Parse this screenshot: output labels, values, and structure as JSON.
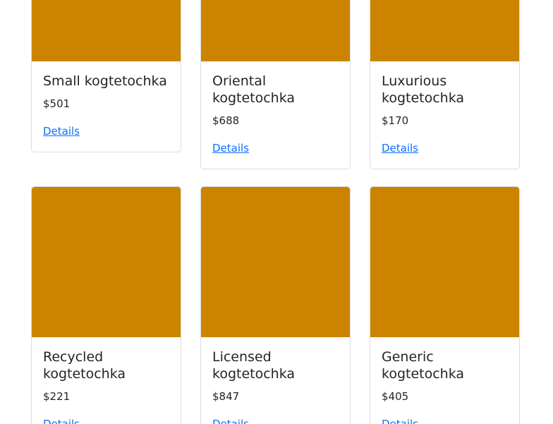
{
  "products": [
    {
      "title": "Small kogtetochka",
      "price": "$501",
      "link": "Details",
      "image_color": "#cc8400"
    },
    {
      "title": "Oriental kogtetochka",
      "price": "$688",
      "link": "Details",
      "image_color": "#cc8400"
    },
    {
      "title": "Luxurious kogtetochka",
      "price": "$170",
      "link": "Details",
      "image_color": "#cc8400"
    },
    {
      "title": "Recycled kogtetochka",
      "price": "$221",
      "link": "Details",
      "image_color": "#cc8400"
    },
    {
      "title": "Licensed kogtetochka",
      "price": "$847",
      "link": "Details",
      "image_color": "#cc8400"
    },
    {
      "title": "Generic kogtetochka",
      "price": "$405",
      "link": "Details",
      "image_color": "#cc8400"
    }
  ],
  "colors": {
    "image_placeholder": "#cc8400",
    "link": "#0d6efd",
    "text": "#212529",
    "card_border": "#dcdcdc"
  }
}
